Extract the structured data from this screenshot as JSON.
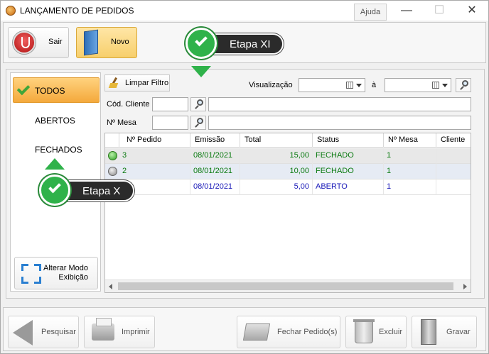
{
  "window": {
    "title": "LANÇAMENTO DE PEDIDOS",
    "help_label": "Ajuda",
    "minimize": "—",
    "maximize": "☐",
    "close": "✕"
  },
  "toolbar": {
    "exit_label": "Sair",
    "new_label": "Novo"
  },
  "filters": {
    "items": [
      "TODOS",
      "ABERTOS",
      "FECHADOS"
    ],
    "active": "TODOS",
    "alter_mode_label_1": "Alterar Modo",
    "alter_mode_label_2": "Exibição"
  },
  "search": {
    "clear_filter_label": "Limpar Filtro",
    "visualization_label": "Visualização",
    "to_label": "à",
    "client_code_label": "Cód. Cliente",
    "table_number_label": "Nº Mesa"
  },
  "grid": {
    "columns": [
      "Nº Pedido",
      "Emissão",
      "Total",
      "Status",
      "Nº Mesa",
      "Cliente"
    ],
    "rows": [
      {
        "pedido": "3",
        "emissao": "08/01/2021",
        "total": "15,00",
        "status": "FECHADO",
        "mesa": "1",
        "cliente": ""
      },
      {
        "pedido": "2",
        "emissao": "08/01/2021",
        "total": "10,00",
        "status": "FECHADO",
        "mesa": "1",
        "cliente": ""
      },
      {
        "pedido": "",
        "emissao": "08/01/2021",
        "total": "5,00",
        "status": "ABERTO",
        "mesa": "1",
        "cliente": ""
      }
    ]
  },
  "bottom": {
    "search_label": "Pesquisar",
    "print_label": "Imprimir",
    "close_orders_label": "Fechar Pedido(s)",
    "delete_label": "Excluir",
    "save_label": "Gravar"
  },
  "callouts": {
    "step_xi": "Etapa XI",
    "step_x": "Etapa X"
  }
}
